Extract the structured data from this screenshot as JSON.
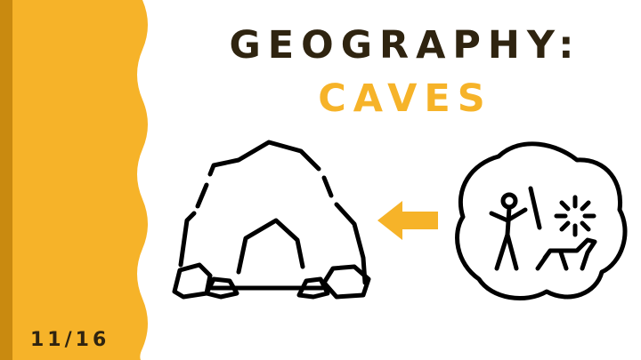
{
  "slide": {
    "title_line1": "GEOGRAPHY:",
    "title_line2": "CAVES",
    "date": "11/16"
  },
  "colors": {
    "accent": "#f6b329",
    "accent_dark": "#c98a10",
    "title_text": "#2f2410",
    "background": "#ffffff",
    "line_art": "#000000"
  },
  "icons": {
    "cave": "cave-icon",
    "arrow": "arrow-left-icon",
    "cave_painting": "cave-painting-icon"
  }
}
